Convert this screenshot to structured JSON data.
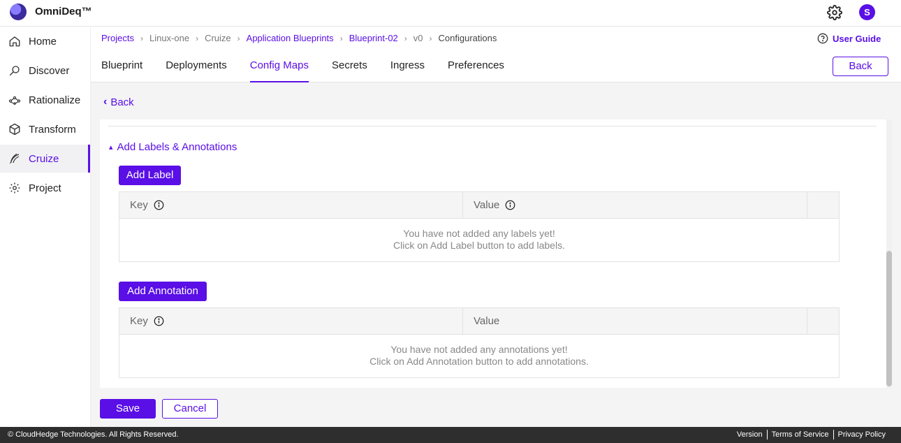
{
  "app": {
    "brand": "OmniDeq™",
    "avatar_initial": "S",
    "accent": "#5a0fe6"
  },
  "sidebar": {
    "items": [
      {
        "label": "Home",
        "icon": "home-icon"
      },
      {
        "label": "Discover",
        "icon": "discover-icon"
      },
      {
        "label": "Rationalize",
        "icon": "rationalize-icon"
      },
      {
        "label": "Transform",
        "icon": "cube-icon"
      },
      {
        "label": "Cruize",
        "icon": "cruize-icon",
        "active": true
      },
      {
        "label": "Project",
        "icon": "gear-icon"
      }
    ]
  },
  "breadcrumb": [
    "Projects",
    "Linux-one",
    "Cruize",
    "Application Blueprints",
    "Blueprint-02",
    "v0",
    "Configurations"
  ],
  "user_guide": "User Guide",
  "tabs": [
    "Blueprint",
    "Deployments",
    "Config Maps",
    "Secrets",
    "Ingress",
    "Preferences"
  ],
  "active_tab": "Config Maps",
  "header_back": "Back",
  "back_link": "Back",
  "section": {
    "title": "Add Labels & Annotations",
    "add_label": "Add Label",
    "add_annotation": "Add Annotation",
    "labels_table": {
      "col_key": "Key",
      "col_value": "Value",
      "empty_line1": "You have not added any labels yet!",
      "empty_line2": "Click on Add Label button to add labels."
    },
    "annotations_table": {
      "col_key": "Key",
      "col_value": "Value",
      "empty_line1": "You have not added any annotations yet!",
      "empty_line2": "Click on Add Annotation button to add annotations."
    }
  },
  "actions": {
    "save": "Save",
    "cancel": "Cancel"
  },
  "footer": {
    "copyright": "© CloudHedge Technologies. All Rights Reserved.",
    "links": [
      "Version",
      "Terms of Service",
      "Privacy Policy"
    ]
  }
}
